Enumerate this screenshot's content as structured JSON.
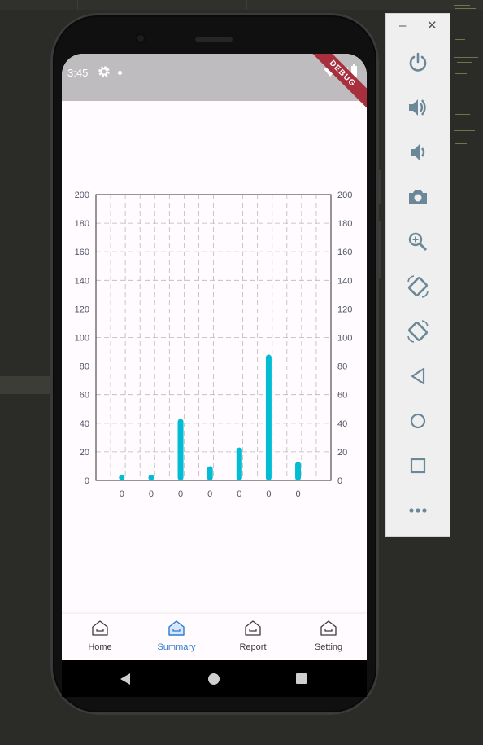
{
  "status_bar": {
    "time": "3:45",
    "banner": "DEBUG"
  },
  "bottom_nav": {
    "items": [
      {
        "label": "Home",
        "icon": "home-icon",
        "active": false
      },
      {
        "label": "Summary",
        "icon": "home-icon",
        "active": true
      },
      {
        "label": "Report",
        "icon": "home-icon",
        "active": false
      },
      {
        "label": "Setting",
        "icon": "home-icon",
        "active": false
      }
    ]
  },
  "emulator_toolbar": {
    "buttons": [
      "power-icon",
      "volume-up-icon",
      "volume-down-icon",
      "camera-icon",
      "zoom-icon",
      "rotate-left-icon",
      "rotate-right-icon",
      "back-icon",
      "home-icon",
      "overview-icon",
      "more-icon"
    ]
  },
  "colors": {
    "bar": "#00bcd4",
    "accent": "#2f7bd0",
    "status_bar": "#bebcbf",
    "ribbon": "#a8303e"
  },
  "chart_data": {
    "type": "bar",
    "categories": [
      "0",
      "0",
      "0",
      "0",
      "0",
      "0",
      "0"
    ],
    "values": [
      4,
      4,
      43,
      10,
      23,
      88,
      13
    ],
    "ylim": [
      0,
      200
    ],
    "y_ticks": [
      0,
      20,
      40,
      60,
      80,
      100,
      120,
      140,
      160,
      180,
      200
    ],
    "right_axis_ticks": [
      0,
      20,
      40,
      60,
      80,
      100,
      120,
      140,
      160,
      180,
      200
    ],
    "grid": true,
    "title": "",
    "xlabel": "",
    "ylabel": ""
  }
}
